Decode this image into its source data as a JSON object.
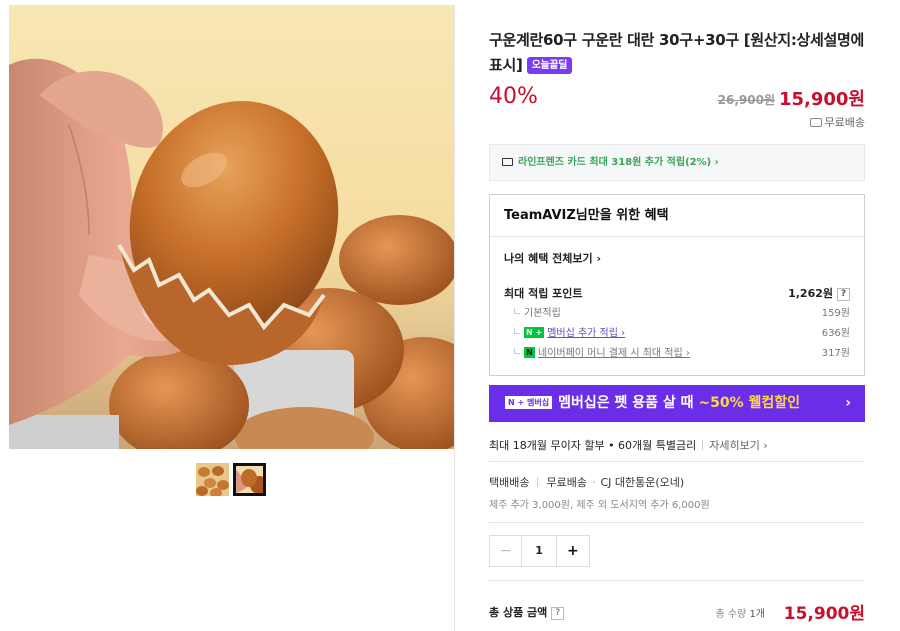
{
  "product": {
    "title": "구운계란60구 구운란 대란 30구+30구 [원산지:상세설명에 표시]",
    "badge": "오늘끝딜",
    "discount": "40%",
    "original_price": "26,900원",
    "sale_price": "15,900원",
    "shipping": "무료배송"
  },
  "card_promo": {
    "text": "라인프렌즈 카드 최대 318원 추가 적립(2%) ›"
  },
  "benefits": {
    "header": "TeamAVIZ님만을 위한 혜택",
    "view_all": "나의 혜택 전체보기 ›",
    "max_points_label": "최대 적립 포인트",
    "max_points_value": "1,262원",
    "help": "?",
    "rows": [
      {
        "label": "기본적립",
        "value": "159원"
      },
      {
        "badge": "N +",
        "label": "멤버십 추가 적립 ›",
        "value": "636원"
      },
      {
        "badge": "N",
        "label": "네이버페이 머니 결제 시 최대 적립 ›",
        "value": "317원"
      }
    ]
  },
  "membership_banner": {
    "tag": "N + 멤버십",
    "text_before": "멤버십은 펫 용품 살 때 ",
    "highlight": "~50% 웰컴할인",
    "arrow": "›"
  },
  "installment": {
    "text": "최대 18개월 무이자 할부 • 60개월 특별금리",
    "more": "자세히보기 ›"
  },
  "delivery": {
    "type": "택배배송",
    "fee": "무료배송",
    "carrier": "CJ 대한통운(오네)",
    "extra": "제주 추가 3,000원, 제주 외 도서지역 추가 6,000원"
  },
  "quantity": {
    "minus": "−",
    "value": "1",
    "plus": "+"
  },
  "total": {
    "label": "총 상품 금액",
    "help": "?",
    "count_label": "총 수량",
    "count_value": "1개",
    "amount": "15,900원"
  },
  "colors": {
    "accent_red": "#c8102e",
    "membership_purple": "#6a2ee8",
    "naver_green": "#00c73c"
  }
}
